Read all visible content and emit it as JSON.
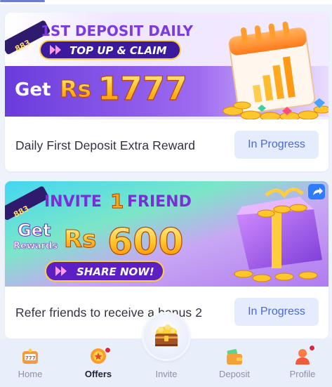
{
  "offers": [
    {
      "badge": "883",
      "headline": "1ST DEPOSIT DAILY",
      "cta": "TOP UP & CLAIM",
      "amount_prefix": "Get",
      "currency": "Rs",
      "amount": "1777",
      "title": "Daily First Deposit Extra Reward",
      "status": "In Progress"
    },
    {
      "badge": "883",
      "headline_a": "INVITE",
      "headline_num": "1",
      "headline_b": "FRIEND",
      "amount_prefix_a": "Get",
      "amount_prefix_b": "Rewards",
      "currency": "Rs",
      "amount": "600",
      "cta": "SHARE NOW!",
      "title": "Refer friends to receive a bonus 2",
      "status": "In Progress"
    }
  ],
  "nav": {
    "items": [
      {
        "label": "Home",
        "active": false,
        "dot": false
      },
      {
        "label": "Offers",
        "active": true,
        "dot": true
      },
      {
        "label": "Invite",
        "active": false,
        "dot": false
      },
      {
        "label": "Deposit",
        "active": false,
        "dot": false
      },
      {
        "label": "Profile",
        "active": false,
        "dot": true
      }
    ]
  }
}
